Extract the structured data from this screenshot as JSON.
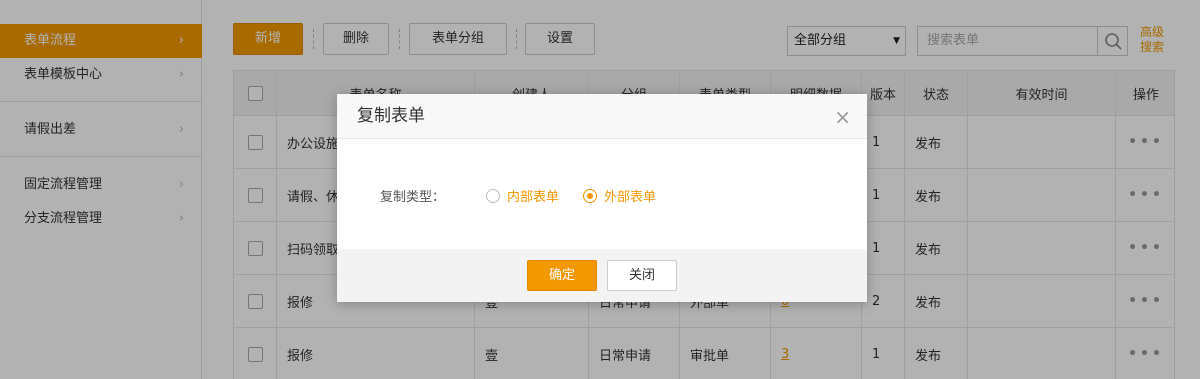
{
  "sidebar": {
    "items": [
      {
        "label": "表单流程",
        "active": true
      },
      {
        "label": "表单模板中心"
      },
      {
        "label": "请假出差"
      },
      {
        "label": "固定流程管理"
      },
      {
        "label": "分支流程管理"
      }
    ],
    "chevron": "›"
  },
  "toolbar": {
    "add_label": "新增",
    "delete_label": "删除",
    "group_label": "表单分组",
    "settings_label": "设置",
    "group_select_value": "全部分组",
    "search_placeholder": "搜索表单",
    "advanced_search_label": "高级搜索"
  },
  "table": {
    "headers": [
      "",
      "表单名称",
      "创建人",
      "分组",
      "表单类型",
      "明细数据",
      "版本",
      "状态",
      "有效时间",
      "操作"
    ],
    "rows": [
      {
        "name": "办公设施",
        "creator": "",
        "group": "",
        "type": "",
        "detail": "",
        "version": "1",
        "status": "发布",
        "valid": "",
        "ops": "•••"
      },
      {
        "name": "请假、休",
        "creator": "",
        "group": "",
        "type": "",
        "detail": "",
        "version": "1",
        "status": "发布",
        "valid": "",
        "ops": "•••"
      },
      {
        "name": "扫码领取",
        "creator": "",
        "group": "",
        "type": "",
        "detail": "",
        "version": "1",
        "status": "发布",
        "valid": "",
        "ops": "•••"
      },
      {
        "name": "报修",
        "creator": "壹",
        "group": "日常申请",
        "type": "外部单",
        "detail": "0",
        "version": "2",
        "status": "发布",
        "valid": "",
        "ops": "•••"
      },
      {
        "name": "报修",
        "creator": "壹",
        "group": "日常申请",
        "type": "审批单",
        "detail": "3",
        "version": "1",
        "status": "发布",
        "valid": "",
        "ops": "•••"
      }
    ]
  },
  "modal": {
    "title": "复制表单",
    "close_icon": "×",
    "copy_type_label": "复制类型：",
    "options": [
      {
        "label": "内部表单",
        "selected": false
      },
      {
        "label": "外部表单",
        "selected": true
      }
    ],
    "confirm_label": "确定",
    "cancel_label": "关闭"
  },
  "colors": {
    "accent": "#f39800",
    "overlay": "rgba(0,0,0,0.3)"
  }
}
